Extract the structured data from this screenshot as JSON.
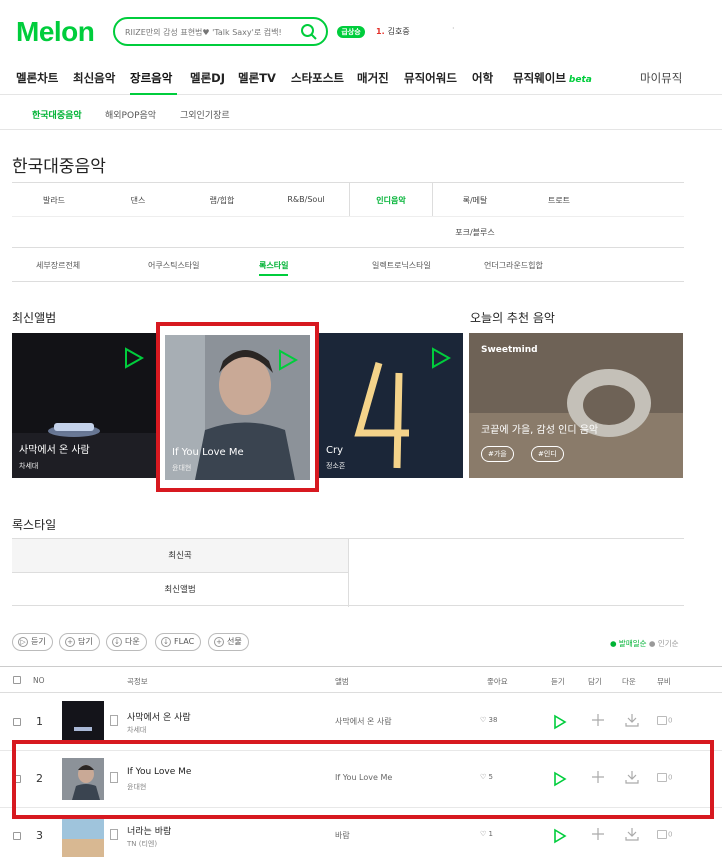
{
  "header": {
    "logo": "Melon",
    "search_placeholder": "RIIZE만의 감성 표현법♥ 'Talk Saxy'로 컴백!",
    "rank_badge": "급상승",
    "rank_num": "1.",
    "rank_name": "김호중",
    "extra": "·"
  },
  "gnb": {
    "items": [
      "멜론차트",
      "최신음악",
      "장르음악",
      "멜론DJ",
      "멜론TV",
      "스타포스트",
      "매거진",
      "뮤직어워드",
      "어학",
      "뮤직웨이브"
    ],
    "beta": "beta",
    "mymusic": "마이뮤직"
  },
  "subnav": [
    "한국대중음악",
    "해외POP음악",
    "그외인기장르"
  ],
  "page_title": "한국대중음악",
  "genres": [
    "발라드",
    "댄스",
    "랩/힙합",
    "R&B/Soul",
    "인디음악",
    "록/메탈",
    "트로트",
    "포크/블루스"
  ],
  "styles": [
    "세부장르전체",
    "어쿠스틱스타일",
    "록스타일",
    "일렉트로닉스타일",
    "언더그라운드힙합"
  ],
  "new_albums": {
    "title": "최신앨범",
    "cards": [
      {
        "title": "사막에서 온 사람",
        "artist": "차세대"
      },
      {
        "title": "If You Love Me",
        "artist": "윤대현"
      },
      {
        "title": "Cry",
        "artist": "정소흔"
      }
    ]
  },
  "reco": {
    "title": "오늘의 추천 음악",
    "brand": "Sweetmind",
    "playlist": "코끝에 가을, 감성 인디 음악",
    "tags": [
      "#가을",
      "#인디"
    ]
  },
  "rock_style": {
    "title": "록스타일",
    "tabs": [
      "최신곡",
      "최신앨범"
    ]
  },
  "toolbar": {
    "buttons": [
      "듣기",
      "담기",
      "다운",
      "FLAC",
      "선물"
    ],
    "sort_on": "● 발매일순",
    "sort_off": "● 인기순"
  },
  "table": {
    "headers": [
      "NO",
      "곡정보",
      "앨범",
      "좋아요",
      "듣기",
      "담기",
      "다운",
      "뮤비"
    ],
    "rows": [
      {
        "no": "1",
        "title": "사막에서 온 사람",
        "artist": "차세대",
        "album": "사막에서 온 사람",
        "likes": "38",
        "mv": "0"
      },
      {
        "no": "2",
        "title": "If You Love Me",
        "artist": "윤대현",
        "album": "If You Love Me",
        "likes": "5",
        "mv": "0"
      },
      {
        "no": "3",
        "title": "너라는 바람",
        "artist": "TN (티엔)",
        "album": "바람",
        "likes": "1",
        "mv": "0"
      }
    ]
  },
  "colors": {
    "brand": "#00cd3c",
    "highlight": "#d71920"
  }
}
